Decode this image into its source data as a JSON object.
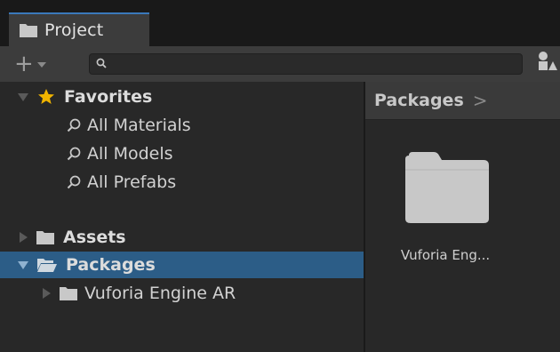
{
  "window": {
    "tab_label": "Project"
  },
  "toolbar": {
    "add_label": "+",
    "search_value": "",
    "search_placeholder": ""
  },
  "tree": {
    "favorites": {
      "label": "Favorites",
      "items": [
        {
          "label": "All Materials"
        },
        {
          "label": "All Models"
        },
        {
          "label": "All Prefabs"
        }
      ]
    },
    "assets": {
      "label": "Assets"
    },
    "packages": {
      "label": "Packages"
    },
    "vuforia": {
      "label": "Vuforia Engine AR"
    }
  },
  "content": {
    "breadcrumb": "Packages",
    "breadcrumb_sep": ">",
    "items": [
      {
        "label": "Vuforia Eng..."
      }
    ]
  },
  "colors": {
    "selection": "#2c5d87",
    "tab_accent": "#3a79bb",
    "star": "#f0b400",
    "folder": "#c8c8c8",
    "panel_bg": "#282828"
  }
}
